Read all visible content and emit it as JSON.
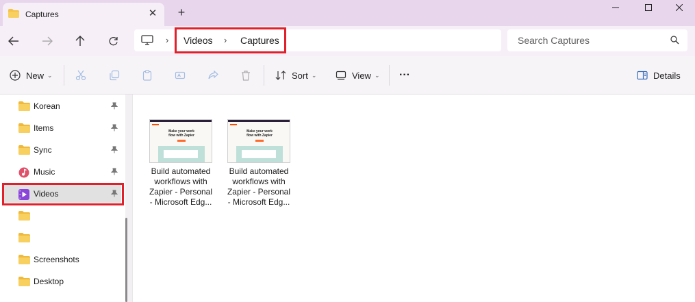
{
  "window": {
    "tab_title": "Captures",
    "tab_close": "✕",
    "tab_add": "+"
  },
  "navigation": {
    "breadcrumbs": [
      "Videos",
      "Captures"
    ],
    "separator": "›",
    "search_placeholder": "Search Captures"
  },
  "commandbar": {
    "new_label": "New",
    "sort_label": "Sort",
    "view_label": "View",
    "more_label": "···",
    "details_label": "Details",
    "chevron": "⌄"
  },
  "sidebar": {
    "items": [
      {
        "label": "Korean",
        "icon": "folder-icon",
        "pinned": true
      },
      {
        "label": "Items",
        "icon": "folder-icon",
        "pinned": true
      },
      {
        "label": "Sync",
        "icon": "folder-icon",
        "pinned": true
      },
      {
        "label": "Music",
        "icon": "music-icon",
        "pinned": true
      },
      {
        "label": "Videos",
        "icon": "videos-icon",
        "pinned": true,
        "selected": true
      },
      {
        "label": "",
        "icon": "folder-icon",
        "pinned": false
      },
      {
        "label": "",
        "icon": "folder-icon",
        "pinned": false
      },
      {
        "label": "Screenshots",
        "icon": "folder-icon",
        "pinned": false
      },
      {
        "label": "Desktop",
        "icon": "folder-icon",
        "pinned": false
      }
    ]
  },
  "files": [
    {
      "name": "Build automated workflows with Zapier - Personal - Microsoft Edg...",
      "thumb_heading": "Make your work flow with Zapier"
    },
    {
      "name": "Build automated workflows with Zapier - Personal - Microsoft Edg...",
      "thumb_heading": "Make your work flow with Zapier"
    }
  ],
  "colors": {
    "accent_highlight": "#e0202a",
    "folder": "#f5c344",
    "titlebar": "#e8d6ec"
  }
}
